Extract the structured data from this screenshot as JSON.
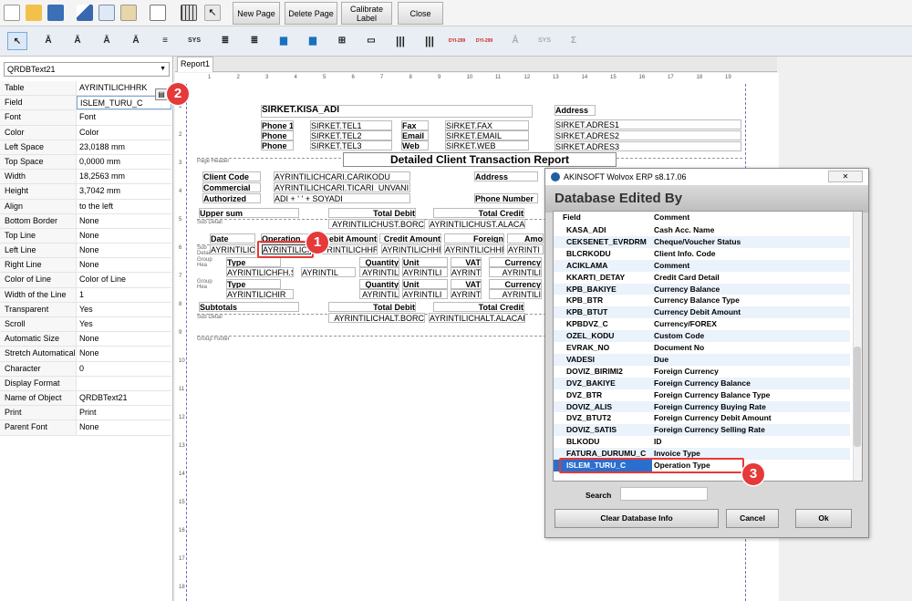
{
  "toolbar": {
    "new_page": "New Page",
    "delete_page": "Delete Page",
    "calibrate_label": "Calibrate Label",
    "close": "Close"
  },
  "toolbar2": {
    "sys": "SYS",
    "barcode_label": "DYI-299"
  },
  "left_panel": {
    "object_selector": "QRDBText21",
    "properties": [
      {
        "name": "Table",
        "value": "AYRINTILICHHRK"
      },
      {
        "name": "Field",
        "value": "ISLEM_TURU_C"
      },
      {
        "name": "Font",
        "value": "Font"
      },
      {
        "name": "Color",
        "value": "Color"
      },
      {
        "name": "Left Space",
        "value": "23,0188 mm"
      },
      {
        "name": "Top Space",
        "value": "0,0000 mm"
      },
      {
        "name": "Width",
        "value": "18,2563 mm"
      },
      {
        "name": "Height",
        "value": "3,7042 mm"
      },
      {
        "name": "Align",
        "value": "to the left"
      },
      {
        "name": "Bottom Border",
        "value": "None"
      },
      {
        "name": "Top Line",
        "value": "None"
      },
      {
        "name": "Left Line",
        "value": "None"
      },
      {
        "name": "Right Line",
        "value": "None"
      },
      {
        "name": "Color of Line",
        "value": "Color of Line"
      },
      {
        "name": "Width of the Line",
        "value": "1"
      },
      {
        "name": "Transparent",
        "value": "Yes"
      },
      {
        "name": "Scroll",
        "value": "Yes"
      },
      {
        "name": "Automatic Size",
        "value": "None"
      },
      {
        "name": "Stretch Automatically",
        "value": "None"
      },
      {
        "name": "Character",
        "value": "0"
      },
      {
        "name": "Display Format",
        "value": ""
      },
      {
        "name": "Name of Object",
        "value": "QRDBText21"
      },
      {
        "name": "Print",
        "value": "Print"
      },
      {
        "name": "Parent Font",
        "value": "None"
      }
    ]
  },
  "report_tab": "Report1",
  "ruler_h": [
    "1",
    "2",
    "3",
    "4",
    "5",
    "6",
    "7",
    "8",
    "9",
    "10",
    "11",
    "12",
    "13",
    "14",
    "15",
    "16",
    "17",
    "18",
    "19"
  ],
  "ruler_v": [
    "1",
    "2",
    "3",
    "4",
    "5",
    "6",
    "7",
    "8",
    "9",
    "10",
    "11",
    "12",
    "13",
    "14",
    "15",
    "16",
    "17",
    "18"
  ],
  "report": {
    "title_field": "SIRKET.KISA_ADI",
    "address_label": "Address",
    "phone_label": "Phone 1",
    "phone2_label": "Phone",
    "phone3_label": "Phone",
    "tel1": "SIRKET.TEL1",
    "tel2": "SIRKET.TEL2",
    "tel3": "SIRKET.TEL3",
    "fax_label": "Fax",
    "email_label": "Email",
    "web_label": "Web",
    "fax": "SIRKET.FAX",
    "email": "SIRKET.EMAIL",
    "web": "SIRKET.WEB",
    "adres1": "SIRKET.ADRES1",
    "adres2": "SIRKET.ADRES2",
    "adres3": "SIRKET.ADRES3",
    "page_header": "Page Header",
    "report_title": "Detailed Client Transaction Report",
    "client_code_label": "Client Code",
    "commercial_label": "Commercial",
    "authorized_label": "Authorized",
    "client_code": "AYRINTILICHCARI.CARIKODU",
    "commercial": "AYRINTILICHCARI.TICARI_UNVANI",
    "authorized": "ADI + ' ' + SOYADI",
    "address2_label": "Address",
    "phone_number_label": "Phone Number",
    "upper_sum": "Upper sum",
    "total_debit": "Total Debit",
    "total_credit": "Total Credit",
    "sub_detail": "Sub Detail",
    "upper_debit_field": "AYRINTILICHUST.BORC",
    "upper_credit_field": "AYRINTILICHUST.ALACAK",
    "date_label": "Date",
    "operation_label": "Operation",
    "debit_amount_label": "Debit Amount",
    "credit_amount_label": "Credit Amount",
    "foreign_label": "Foreign",
    "amo_label": "Amo",
    "row_date": "AYRINTILIC",
    "row_operation": "AYRINTILICH",
    "row_debit": "AYRINTILICHHR",
    "row_credit": "AYRINTILICHHR",
    "row_foreign": "AYRINTILICHHR",
    "row_amo": "AYRINTI",
    "group_header": "Group Hea",
    "type_label": "Type",
    "quantity_label": "Quantity",
    "unit_label": "Unit",
    "vat_label": "VAT",
    "currency_label": "Currency",
    "type_field1": "AYRINTILICHFH.S",
    "type_field2": "AYRINTIL",
    "type_field3": "AYRINTILICHIR",
    "small_field": "AYRINTIL",
    "small_field2": "AYRINTILI",
    "small_field3": "AYRINTI",
    "subtotals": "Subtotals",
    "alt_debit_field": "AYRINTILICHALT.BORC",
    "alt_credit_field": "AYRINTILICHALT.ALACAK",
    "group_footer": "Group Footer"
  },
  "dialog": {
    "title": "AKINSOFT Wolvox ERP s8.17.06",
    "header": "Database Edited By",
    "col_field": "Field",
    "col_comment": "Comment",
    "rows": [
      {
        "field": "KASA_ADI",
        "comment": "Cash Acc. Name"
      },
      {
        "field": "CEKSENET_EVRDRM",
        "comment": "Cheque/Voucher Status"
      },
      {
        "field": "BLCRKODU",
        "comment": "Client Info. Code"
      },
      {
        "field": "ACIKLAMA",
        "comment": "Comment"
      },
      {
        "field": "KKARTI_DETAY",
        "comment": "Credit Card Detail"
      },
      {
        "field": "KPB_BAKIYE",
        "comment": "Currency Balance"
      },
      {
        "field": "KPB_BTR",
        "comment": "Currency Balance Type"
      },
      {
        "field": "KPB_BTUT",
        "comment": "Currency Debit Amount"
      },
      {
        "field": "KPBDVZ_C",
        "comment": "Currency/FOREX"
      },
      {
        "field": "OZEL_KODU",
        "comment": "Custom Code"
      },
      {
        "field": "EVRAK_NO",
        "comment": "Document No"
      },
      {
        "field": "VADESI",
        "comment": "Due"
      },
      {
        "field": "DOVIZ_BIRIMI2",
        "comment": "Foreign Currency"
      },
      {
        "field": "DVZ_BAKIYE",
        "comment": "Foreign Currency Balance"
      },
      {
        "field": "DVZ_BTR",
        "comment": "Foreign Currency Balance Type"
      },
      {
        "field": "DOVIZ_ALIS",
        "comment": "Foreign Currency Buying Rate"
      },
      {
        "field": "DVZ_BTUT2",
        "comment": "Foreign Currency Debit Amount"
      },
      {
        "field": "DOVIZ_SATIS",
        "comment": "Foreign Currency Selling Rate"
      },
      {
        "field": "BLKODU",
        "comment": "ID"
      },
      {
        "field": "FATURA_DURUMU_C",
        "comment": "Invoice Type"
      },
      {
        "field": "ISLEM_TURU_C",
        "comment": "Operation Type"
      }
    ],
    "search_label": "Search",
    "search_value": "",
    "clear_button": "Clear Database Info",
    "cancel_button": "Cancel",
    "ok_button": "Ok",
    "close_symbol": "✕"
  },
  "badges": {
    "one": "1",
    "two": "2",
    "three": "3"
  }
}
